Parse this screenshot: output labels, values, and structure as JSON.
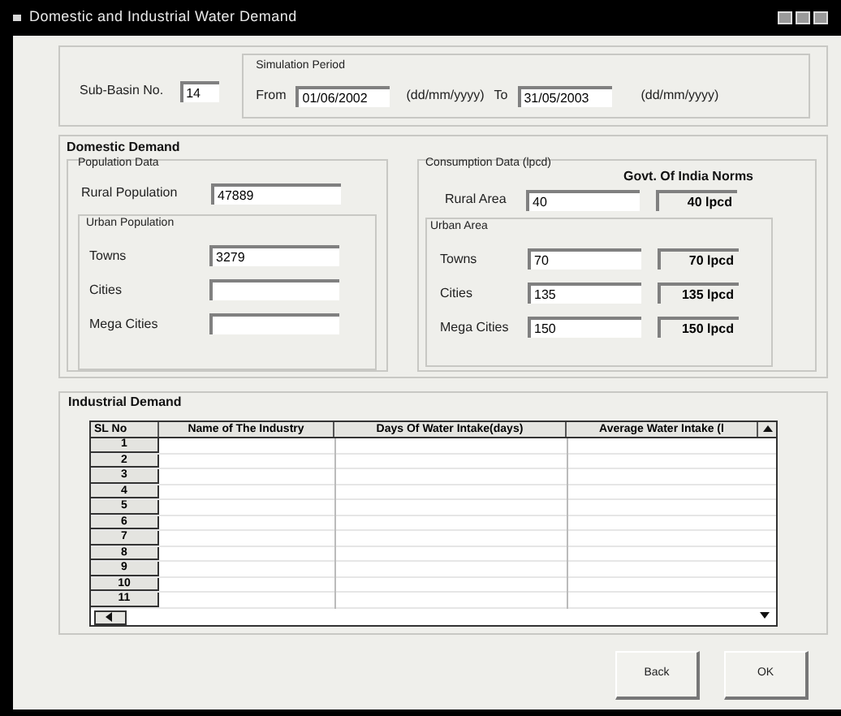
{
  "window": {
    "title": "Domestic  and Industrial Water Demand"
  },
  "sub_basin": {
    "label": "Sub-Basin No.",
    "value": "14"
  },
  "simulation_period": {
    "title": "Simulation Period",
    "from_label": "From",
    "from_value": "01/06/2002",
    "from_format": "(dd/mm/yyyy)",
    "to_label": "To",
    "to_value": "31/05/2003",
    "to_format": "(dd/mm/yyyy)"
  },
  "domestic_demand": {
    "title": "Domestic Demand",
    "population": {
      "title": "Population Data",
      "rural": {
        "label": "Rural Population",
        "value": "47889"
      },
      "urban_title": "Urban Population",
      "urban": [
        {
          "label": "Towns",
          "value": "3279"
        },
        {
          "label": "Cities"
        },
        {
          "label": "Mega Cities"
        }
      ]
    },
    "consumption": {
      "title": "Consumption Data (lpcd)",
      "norms_title": "Govt. Of India Norms",
      "rural": {
        "label": "Rural Area",
        "value": "40",
        "norm": "40 lpcd"
      },
      "urban_title": "Urban Area",
      "urban": [
        {
          "label": "Towns",
          "value": "70",
          "norm": "70 lpcd"
        },
        {
          "label": "Cities",
          "value": "135",
          "norm": "135 lpcd"
        },
        {
          "label": "Mega Cities",
          "value": "150",
          "norm": "150 lpcd"
        }
      ]
    }
  },
  "industrial_demand": {
    "title": "Industrial Demand",
    "columns": [
      "SL No",
      "Name of The Industry",
      "Days Of Water Intake(days)",
      "Average Water Intake (l"
    ],
    "rows": [
      "1",
      "2",
      "3",
      "4",
      "5",
      "6",
      "7",
      "8",
      "9",
      "10",
      "11"
    ]
  },
  "buttons": [
    "Back",
    "OK"
  ]
}
